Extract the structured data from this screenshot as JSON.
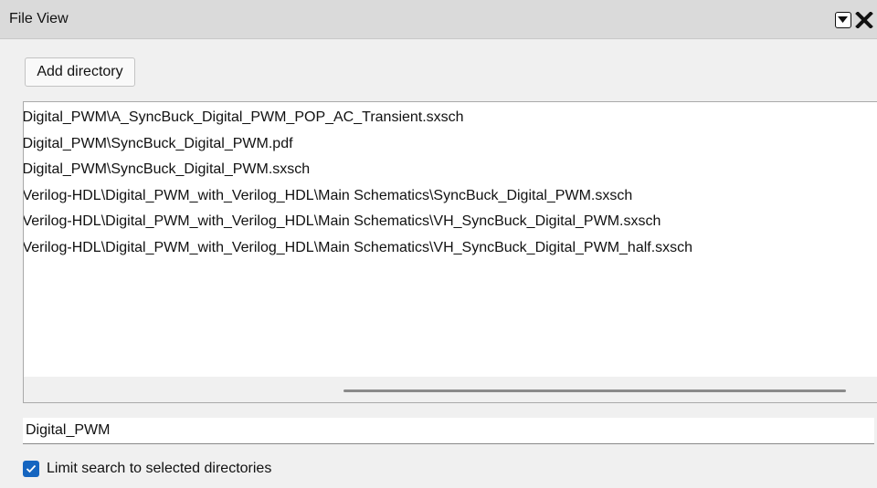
{
  "panel": {
    "title": "File View",
    "dropdown_icon": "triangle-down-icon",
    "close_icon": "close-x-icon"
  },
  "toolbar": {
    "add_directory_label": "Add directory"
  },
  "file_list": [
    "\\Digital_PWM\\A_SyncBuck_Digital_PWM_POP_AC_Transient.sxsch",
    "\\Digital_PWM\\SyncBuck_Digital_PWM.pdf",
    "\\Digital_PWM\\SyncBuck_Digital_PWM.sxsch",
    "\\Verilog-HDL\\Digital_PWM_with_Verilog_HDL\\Main Schematics\\SyncBuck_Digital_PWM.sxsch",
    "\\Verilog-HDL\\Digital_PWM_with_Verilog_HDL\\Main Schematics\\VH_SyncBuck_Digital_PWM.sxsch",
    "\\Verilog-HDL\\Digital_PWM_with_Verilog_HDL\\Main Schematics\\VH_SyncBuck_Digital_PWM_half.sxsch"
  ],
  "search": {
    "value": "Digital_PWM"
  },
  "options": {
    "limit_search_label": "Limit search to selected directories",
    "limit_search_checked": true
  },
  "colors": {
    "checkbox_accent": "#1565c0",
    "titlebar_bg": "#dadada",
    "panel_bg": "#f0f0f0"
  }
}
